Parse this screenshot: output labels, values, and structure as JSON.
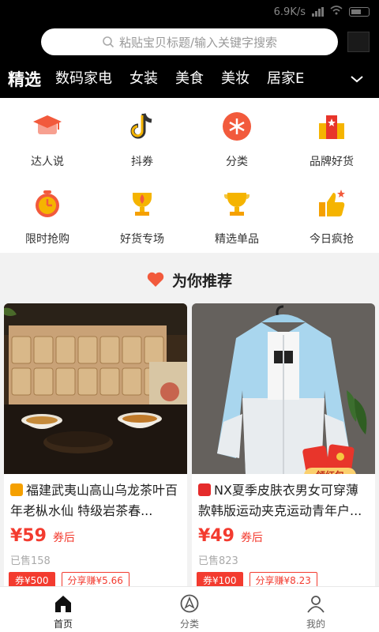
{
  "status_bar": {
    "speed": "6.9K/s"
  },
  "search": {
    "placeholder": "粘贴宝贝标题/输入关键字搜索"
  },
  "category_tabs": [
    "精选",
    "数码家电",
    "女装",
    "美食",
    "美妆",
    "居家E"
  ],
  "quick_entries": [
    {
      "label": "达人说",
      "icon": "graduation-cap-icon",
      "color": "#f25a3c"
    },
    {
      "label": "抖券",
      "icon": "tiktok-icon",
      "color": "#f5b400"
    },
    {
      "label": "分类",
      "icon": "category-circle-icon",
      "color": "#f25a3c"
    },
    {
      "label": "品牌好货",
      "icon": "brand-box-icon",
      "color": "#f5b400"
    },
    {
      "label": "限时抢购",
      "icon": "alarm-clock-icon",
      "color": "#f25a3c"
    },
    {
      "label": "好货专场",
      "icon": "trophy-fire-icon",
      "color": "#f5b400"
    },
    {
      "label": "精选单品",
      "icon": "trophy-icon",
      "color": "#f5b400"
    },
    {
      "label": "今日疯抢",
      "icon": "thumbs-up-icon",
      "color": "#f5a000"
    }
  ],
  "recommend": {
    "title": "为你推荐"
  },
  "products": [
    {
      "name": "福建武夷山高山乌龙茶叶百年老枞水仙 特级岩茶春...",
      "price": "¥59",
      "after": "券后",
      "sold": "已售158",
      "coupon": "券¥500",
      "share": "分享赚¥5.66",
      "source_color": "#f5a000"
    },
    {
      "name": "NX夏季皮肤衣男女可穿薄款韩版运动夹克运动青年户...",
      "price": "¥49",
      "after": "券后",
      "sold": "已售823",
      "coupon": "券¥100",
      "share": "分享赚¥8.23",
      "source_color": "#e52b2b",
      "redpack_label": "领红包"
    }
  ],
  "bottom_nav": [
    {
      "label": "首页",
      "icon": "home-icon",
      "active": true
    },
    {
      "label": "分类",
      "icon": "compass-icon",
      "active": false
    },
    {
      "label": "我的",
      "icon": "user-icon",
      "active": false
    }
  ],
  "colors": {
    "accent": "#f33b2f",
    "header_bg": "#000000"
  }
}
